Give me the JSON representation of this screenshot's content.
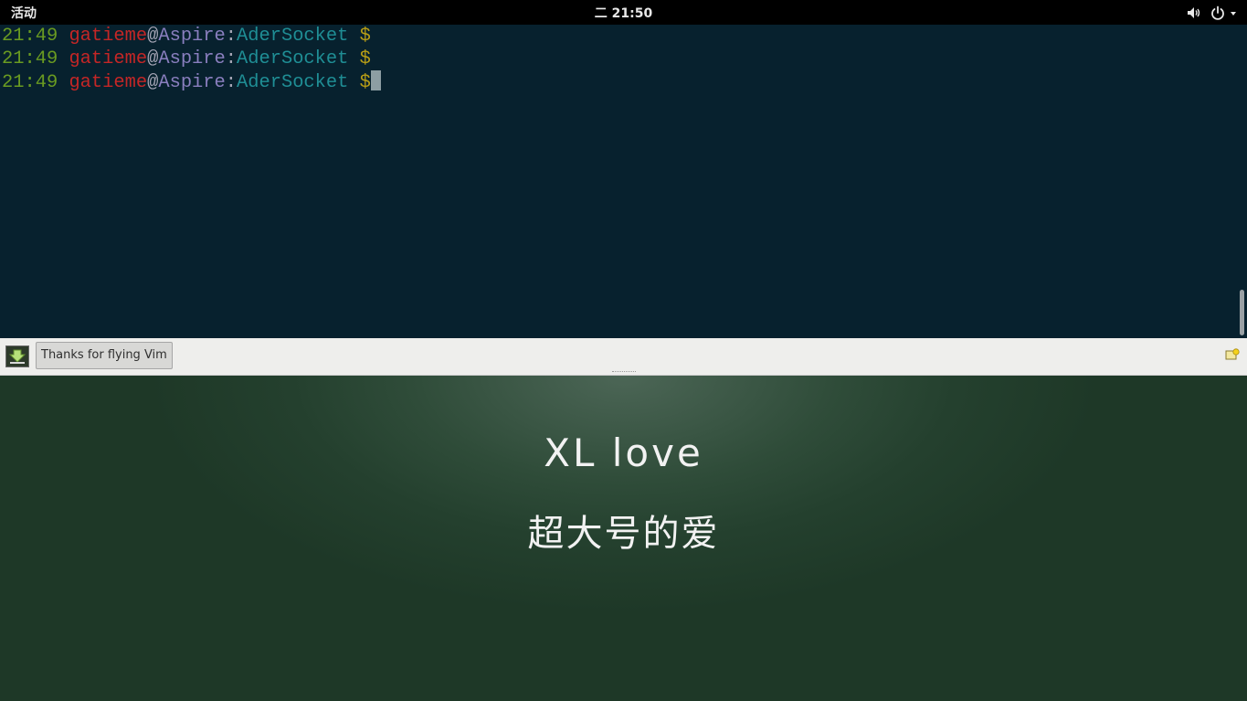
{
  "topbar": {
    "activities_label": "活动",
    "clock_label": "二 21:50",
    "volume_icon": "volume-icon",
    "power_icon": "power-icon"
  },
  "terminal": {
    "lines": [
      {
        "time": "21:49",
        "user": "gatieme",
        "at": "@",
        "host": "Aspire",
        "colon": ":",
        "path": "AderSocket",
        "prompt": " $"
      },
      {
        "time": "21:49",
        "user": "gatieme",
        "at": "@",
        "host": "Aspire",
        "colon": ":",
        "path": "AderSocket",
        "prompt": " $"
      },
      {
        "time": "21:49",
        "user": "gatieme",
        "at": "@",
        "host": "Aspire",
        "colon": ":",
        "path": "AderSocket",
        "prompt": " $"
      }
    ]
  },
  "panel": {
    "task_label": "Thanks for flying Vim",
    "left_icon": "download-icon",
    "right_icon": "notification-icon"
  },
  "wallpaper": {
    "line1": "XL love",
    "line2": "超大号的爱"
  },
  "colors": {
    "terminal_bg": "#07212e",
    "time": "#6a9b21",
    "user": "#c42626",
    "path": "#1f8e95",
    "prompt": "#b79d16",
    "wallpaper": "#2f4c39"
  }
}
